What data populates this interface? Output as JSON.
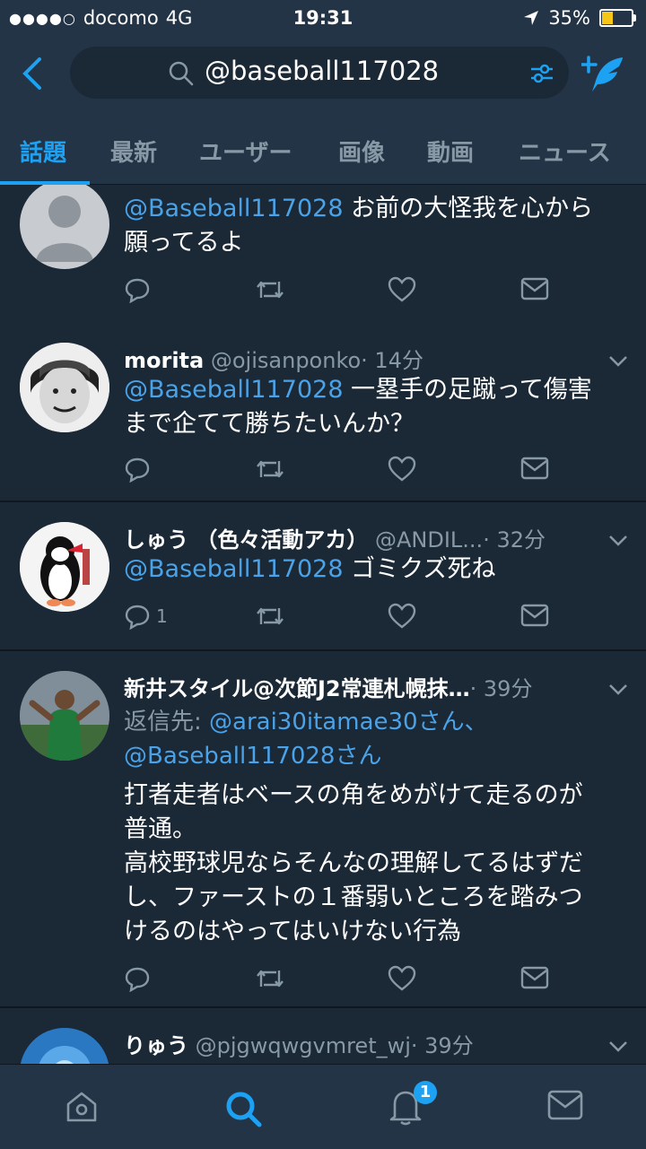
{
  "status_bar": {
    "signal": "●●●●○",
    "carrier": "docomo",
    "network": "4G",
    "time": "19:31",
    "battery": "35%"
  },
  "search": {
    "query": "@baseball117028"
  },
  "tabs": [
    "話題",
    "最新",
    "ユーザー",
    "画像",
    "動画",
    "ニュース"
  ],
  "active_tab": "話題",
  "tweets": [
    {
      "mention": "@Baseball117028",
      "text_1": " お前の大怪我を心から",
      "text_2": "願ってるよ"
    },
    {
      "name": "morita",
      "handle": "@ojisanponko",
      "time": "· 14分",
      "mention": "@Baseball117028",
      "text_1": " 一塁手の足蹴って傷害",
      "text_2": "まで企てて勝ちたいんか？"
    },
    {
      "name": "しゅう （色々活動アカ）",
      "handle": "@ANDIL...",
      "time": "· 32分",
      "mention": "@Baseball117028",
      "text_1": " ゴミクズ死ね",
      "reply_count": "1"
    },
    {
      "name": "新井スタイル@次節J2常連札幌抹…",
      "time": "· 39分",
      "reply_to_label": "返信先: ",
      "reply_to_1": "@arai30itamae30さん、",
      "reply_to_2": "@Baseball117028さん",
      "lines": [
        "打者走者はベースの角をめがけて走るのが",
        "普通。",
        "高校野球児ならそんなの理解してるはずだ",
        "し、ファーストの１番弱いところを踏みつ",
        "けるのはやってはいけない行為"
      ]
    },
    {
      "name": "りゅう",
      "handle": "@pjgwqwgvmret_wj",
      "time": "· 39分"
    }
  ],
  "notifications_badge": "1",
  "colors": {
    "accent": "#1da1f2",
    "background": "#1b2836",
    "bar": "#243447",
    "muted": "#8899a6"
  }
}
